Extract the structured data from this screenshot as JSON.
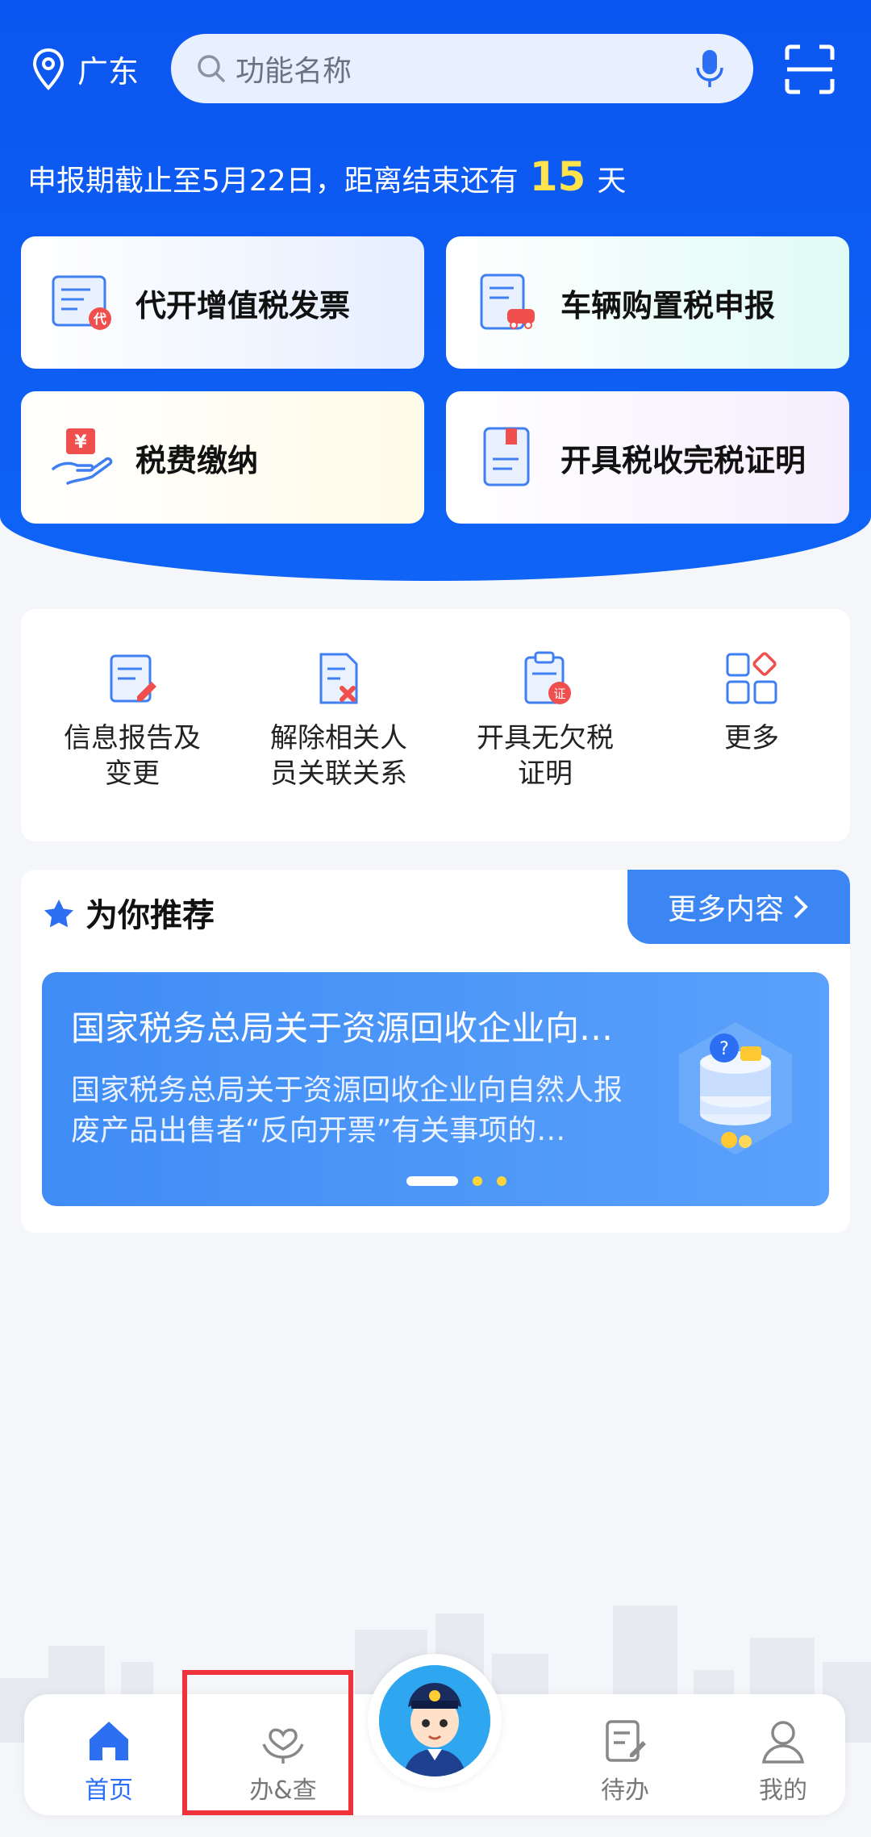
{
  "header": {
    "location": "广东",
    "search_placeholder": "功能名称",
    "deadline_prefix": "申报期截止至5月22日，距离结束还有",
    "deadline_days": "15",
    "deadline_suffix": "天"
  },
  "main_cards": [
    {
      "label": "代开增值税发票",
      "icon": "invoice-icon"
    },
    {
      "label": "车辆购置税申报",
      "icon": "vehicle-tax-icon"
    },
    {
      "label": "税费缴纳",
      "icon": "tax-payment-icon"
    },
    {
      "label": "开具税收完税证明",
      "icon": "tax-certificate-icon"
    }
  ],
  "quick_functions": [
    {
      "label": "信息报告及\n变更",
      "icon": "info-report-icon"
    },
    {
      "label": "解除相关人\n员关联关系",
      "icon": "unlink-icon"
    },
    {
      "label": "开具无欠税\n证明",
      "icon": "no-arrears-icon"
    },
    {
      "label": "更多",
      "icon": "more-grid-icon"
    }
  ],
  "recommend": {
    "title": "为你推荐",
    "more_label": "更多内容",
    "banner_title": "国家税务总局关于资源回收企业向…",
    "banner_desc": "国家税务总局关于资源回收企业向自然人报废产品出售者“反向开票”有关事项的…"
  },
  "bottom_nav": [
    {
      "label": "首页",
      "icon": "home-icon",
      "active": true
    },
    {
      "label": "办&查",
      "icon": "handle-query-icon",
      "active": false
    },
    {
      "label": "待办",
      "icon": "todo-icon",
      "active": false
    },
    {
      "label": "我的",
      "icon": "profile-icon",
      "active": false
    }
  ],
  "colors": {
    "primary": "#0b56f0",
    "accent_yellow": "#ffe34d",
    "highlight": "#f0323c"
  }
}
